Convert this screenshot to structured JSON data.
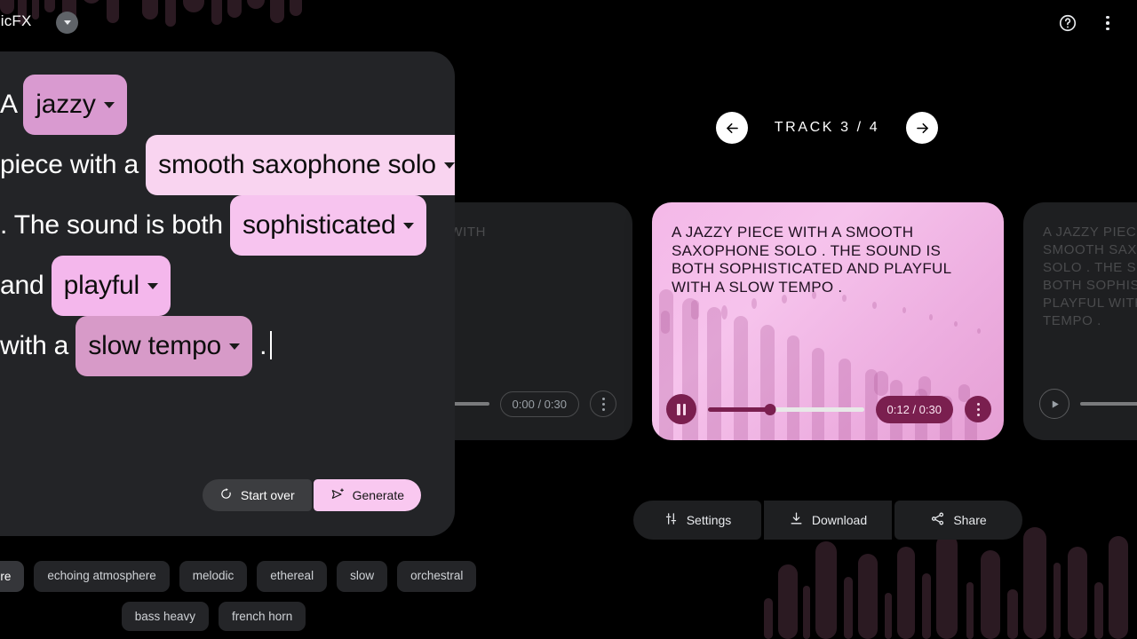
{
  "app": {
    "brand": "MusicFX",
    "brand_chip_icon": "chevron-down-icon",
    "help_icon": "help-circle-icon",
    "overflow_icon": "more-vertical-icon"
  },
  "carousel": {
    "header": {
      "prev_icon": "arrow-left-icon",
      "next_icon": "arrow-right-icon",
      "label": "TRACK  3 / 4"
    },
    "prev_card": {
      "text": "D TRUMPS, WITH",
      "play_icon": "play-icon",
      "time": "0:00 / 0:30",
      "more_icon": "more-vertical-icon"
    },
    "active_card": {
      "text": "A JAZZY PIECE WITH A SMOOTH SAXOPHONE SOLO . THE SOUND IS BOTH SOPHISTICATED AND PLAYFUL WITH A SLOW TEMPO .",
      "pause_icon": "pause-icon",
      "time": "0:12 / 0:30",
      "more_icon": "more-vertical-icon",
      "progress_percent": 40,
      "accent_color": "#7a1f4f",
      "card_color": "#f4b8e8"
    },
    "next_card": {
      "text": "A JAZZY PIECE WITH A SMOOTH SAXOPHONE SOLO . THE SOUND IS BOTH SOPHISTICATED AND PLAYFUL WITH A SLOW TEMPO .",
      "play_icon": "play-icon"
    }
  },
  "actions": {
    "settings_label": "Settings",
    "settings_icon": "tune-icon",
    "download_label": "Download",
    "download_icon": "download-icon",
    "share_label": "Share",
    "share_icon": "share-icon"
  },
  "prompt": {
    "segments": [
      {
        "kind": "text",
        "value": "A "
      },
      {
        "kind": "chip",
        "value": "jazzy",
        "color": "#d99ad0"
      },
      {
        "kind": "text",
        "value": " piece with a "
      },
      {
        "kind": "chip",
        "value": "smooth saxophone solo",
        "color": "#f9d4f0"
      },
      {
        "kind": "text",
        "value": " . The sound is both "
      },
      {
        "kind": "chip",
        "value": "sophisticated",
        "color": "#f7c4ef"
      },
      {
        "kind": "text",
        "value": " and "
      },
      {
        "kind": "chip",
        "value": "playful",
        "color": "#f4b7ec"
      },
      {
        "kind": "text",
        "value": " with a "
      },
      {
        "kind": "chip",
        "value": "slow tempo",
        "color": "#d79ac8"
      },
      {
        "kind": "text",
        "value": " ."
      }
    ],
    "report_icon": "flag-icon",
    "start_over_label": "Start over",
    "start_over_icon": "restart-icon",
    "generate_label": "Generate",
    "generate_icon": "send-sparkle-icon"
  },
  "suggestions": {
    "more_label": "More",
    "more_icon": "refresh-icon",
    "row1": [
      "echoing atmosphere",
      "melodic",
      "ethereal",
      "slow",
      "orchestral"
    ],
    "row2": [
      "bass heavy",
      "french horn"
    ]
  },
  "background": {
    "bar_color": "#2b1a22",
    "top_bars": [
      [
        0,
        16,
        46
      ],
      [
        20,
        10,
        58
      ],
      [
        36,
        8,
        52
      ],
      [
        50,
        12,
        44
      ],
      [
        70,
        16,
        60
      ],
      [
        92,
        22,
        34
      ],
      [
        120,
        14,
        56
      ],
      [
        142,
        10,
        24
      ],
      [
        160,
        18,
        52
      ],
      [
        186,
        12,
        60
      ],
      [
        206,
        24,
        44
      ],
      [
        238,
        12,
        58
      ],
      [
        256,
        16,
        50
      ],
      [
        278,
        20,
        40
      ],
      [
        304,
        16,
        56
      ],
      [
        326,
        14,
        48
      ]
    ],
    "bottom_bars": [
      [
        0,
        10,
        46
      ],
      [
        16,
        22,
        84
      ],
      [
        44,
        8,
        60
      ],
      [
        58,
        24,
        110
      ],
      [
        90,
        10,
        70
      ],
      [
        106,
        22,
        96
      ],
      [
        136,
        8,
        52
      ],
      [
        150,
        20,
        104
      ],
      [
        178,
        10,
        74
      ],
      [
        194,
        24,
        118
      ],
      [
        228,
        8,
        64
      ],
      [
        244,
        22,
        100
      ],
      [
        274,
        12,
        56
      ],
      [
        292,
        26,
        126
      ],
      [
        326,
        8,
        86
      ],
      [
        342,
        22,
        104
      ],
      [
        372,
        10,
        64
      ],
      [
        388,
        22,
        116
      ]
    ]
  }
}
